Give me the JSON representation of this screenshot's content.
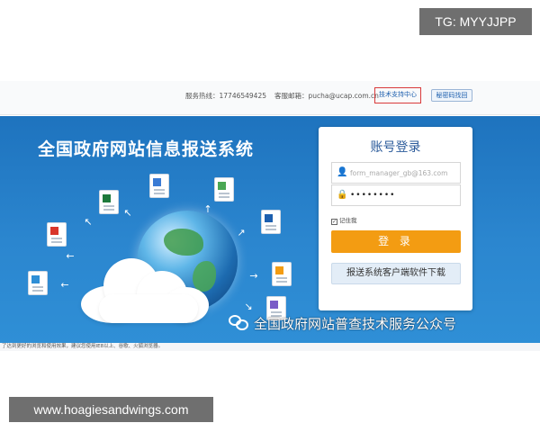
{
  "watermarks": {
    "top": "TG: MYYJJPP",
    "bottom": "www.hoagiesandwings.com"
  },
  "topbar": {
    "hotline": "服务热线：17746549425",
    "email": "客服邮箱：pucha@ucap.com.cn",
    "tech_support": "技术支持中心",
    "password_recovery": "秘密码找回"
  },
  "banner": {
    "title": "全国政府网站信息报送系统"
  },
  "login": {
    "title": "账号登录",
    "username_placeholder": "form_manager_gb@163.com",
    "password_value": "••••••••",
    "remember_label": "记住我",
    "submit_label": "登 录",
    "download_label": "报送系统客户端软件下载"
  },
  "browser_tip": "了达到更好的浏览和使用效果，建议您使用IE8以上、谷歌、火狐浏览器。",
  "wechat_overlay": "全国政府网站普查技术服务公众号",
  "colors": {
    "banner_blue": "#1e73be",
    "login_button": "#f39c12",
    "highlight_border": "#d93a3a"
  },
  "icons": [
    "user-icon",
    "lock-icon",
    "checkbox-icon",
    "wechat-icon",
    "excel-icon",
    "pdf-icon",
    "document-icon",
    "chart-icon",
    "globe-icon",
    "cloud-icon"
  ]
}
